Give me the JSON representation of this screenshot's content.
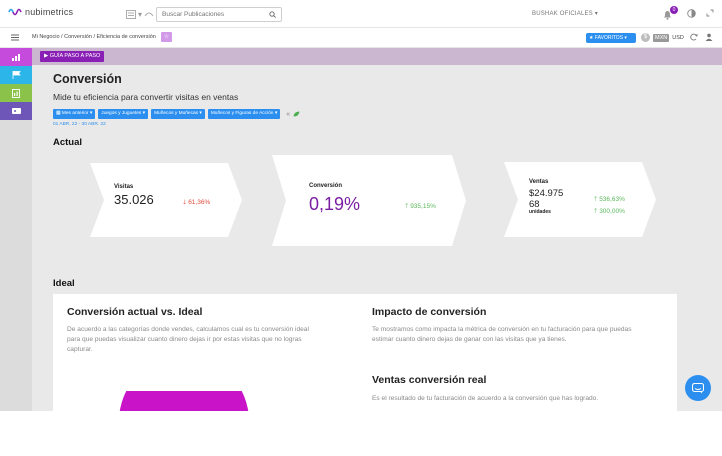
{
  "app": {
    "brand": "nubimetrics",
    "brand_color": "#8a1fb6",
    "accent_color": "#2c8ff0"
  },
  "topbar": {
    "search_placeholder": "Buscar Publicaciones",
    "account_label": "BUSHAK OFICIALES",
    "notification_count": "0",
    "icons": [
      "search-icon",
      "bell-icon",
      "contrast-icon",
      "expand-icon"
    ]
  },
  "subbar": {
    "breadcrumb": "Mi Negocio / Conversión / Eficiencia de conversión",
    "favorites_label": "FAVORITOS",
    "currency_options": [
      "MXN",
      "USD"
    ],
    "currency_symbol": "$",
    "currency_selected": "MXN"
  },
  "sidebar": {
    "items": [
      {
        "icon": "bar-chart-icon",
        "color": "#c44bdc"
      },
      {
        "icon": "flag-icon",
        "color": "#2cb5e8"
      },
      {
        "icon": "report-icon",
        "color": "#8bc34a"
      },
      {
        "icon": "ticket-icon",
        "color": "#6d56b8"
      }
    ]
  },
  "guide_button": "GUÍA PASO A PASO",
  "page": {
    "title": "Conversión",
    "subtitle": "Mide tu eficiencia para convertir visitas en ventas",
    "filters": [
      "Mes anterior",
      "Juegos y Juguetes",
      "Muñecos y Muñecas",
      "Muñecos y Figuras de Acción"
    ],
    "date_range": "01 ABR. 22 - 30 ABR. 22"
  },
  "actual": {
    "heading": "Actual",
    "visits": {
      "label": "Visitas",
      "value": "35.026",
      "change": "61,36%",
      "trend": "down"
    },
    "conversion": {
      "label": "Conversión",
      "value": "0,19%",
      "change": "935,15%",
      "trend": "up"
    },
    "sales": {
      "label": "Ventas",
      "amount": "$24.975",
      "amount_change": "536,63%",
      "units": "68",
      "units_label": "unidades",
      "units_change": "300,00%"
    }
  },
  "ideal": {
    "heading": "Ideal",
    "left": {
      "title": "Conversión actual vs. Ideal",
      "text": "De acuerdo a las categorías donde vendes, calculamos cual es tu conversión ideal para que puedas visualizar cuanto dinero dejas ir por estas visitas que no logras capturar."
    },
    "right_top": {
      "title": "Impacto de conversión",
      "text": "Te mostramos como impacta la métrica de conversión en tu facturación para que puedas estimar cuanto dinero dejas de ganar con las visitas que ya tienes."
    },
    "right_bottom": {
      "title": "Ventas conversión real",
      "text": "Es el resultado de tu facturación de acuerdo a la conversión que has logrado."
    }
  }
}
